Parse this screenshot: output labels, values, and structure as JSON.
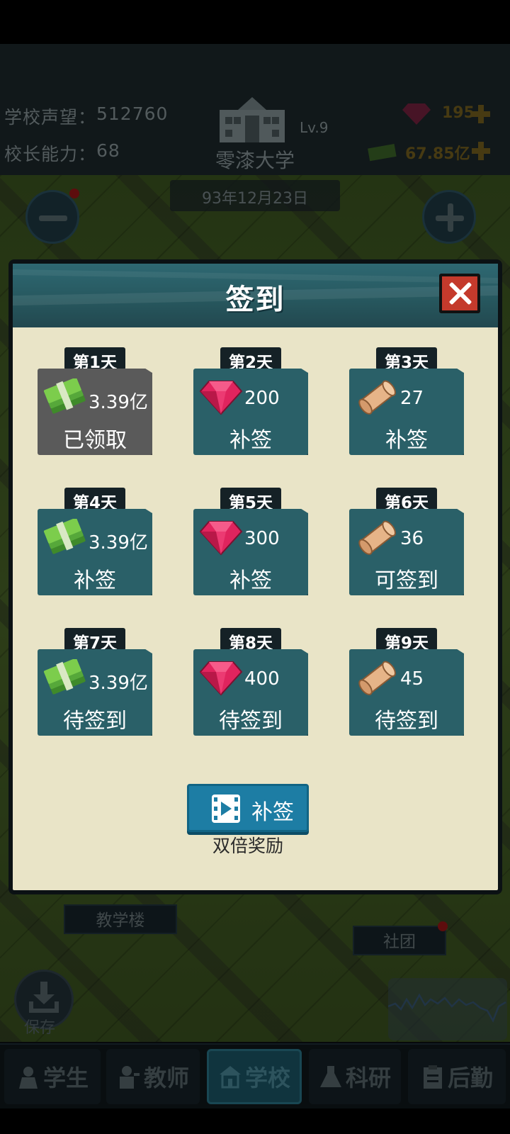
{
  "hud": {
    "prestige_label": "学校声望：",
    "prestige_value": "512760",
    "ability_label": "校长能力：",
    "ability_value": "68",
    "level": "Lv.9",
    "school_name": "零漆大学",
    "date": "93年12月23日",
    "gems": "195",
    "money": "67.85亿"
  },
  "map": {
    "label_teaching": "教学楼",
    "label_club": "社团",
    "save_label": "保存"
  },
  "dialog": {
    "title": "签到",
    "makeup_button": "补签",
    "double_reward": "双倍奖励",
    "days": [
      {
        "day": "第1天",
        "icon": "money-stack-icon",
        "amount": "3.39亿",
        "status": "已领取"
      },
      {
        "day": "第2天",
        "icon": "gem-icon",
        "amount": "200",
        "status": "补签"
      },
      {
        "day": "第3天",
        "icon": "scroll-icon",
        "amount": "27",
        "status": "补签"
      },
      {
        "day": "第4天",
        "icon": "money-stack-icon",
        "amount": "3.39亿",
        "status": "补签"
      },
      {
        "day": "第5天",
        "icon": "gem-icon",
        "amount": "300",
        "status": "补签"
      },
      {
        "day": "第6天",
        "icon": "scroll-icon",
        "amount": "36",
        "status": "可签到"
      },
      {
        "day": "第7天",
        "icon": "money-stack-icon",
        "amount": "3.39亿",
        "status": "待签到"
      },
      {
        "day": "第8天",
        "icon": "gem-icon",
        "amount": "400",
        "status": "待签到"
      },
      {
        "day": "第9天",
        "icon": "scroll-icon",
        "amount": "45",
        "status": "待签到"
      }
    ]
  },
  "nav": {
    "tabs": [
      {
        "label": "学生",
        "icon": "student-icon"
      },
      {
        "label": "教师",
        "icon": "teacher-icon"
      },
      {
        "label": "学校",
        "icon": "school-icon"
      },
      {
        "label": "科研",
        "icon": "flask-icon"
      },
      {
        "label": "后勤",
        "icon": "clipboard-icon"
      }
    ]
  },
  "colors": {
    "dialog_bg": "#e9e4c7",
    "card_bg": "#2a6068",
    "card_done_bg": "#5a5a5a",
    "close_red": "#c43a2c",
    "button_blue": "#1d7da4"
  }
}
